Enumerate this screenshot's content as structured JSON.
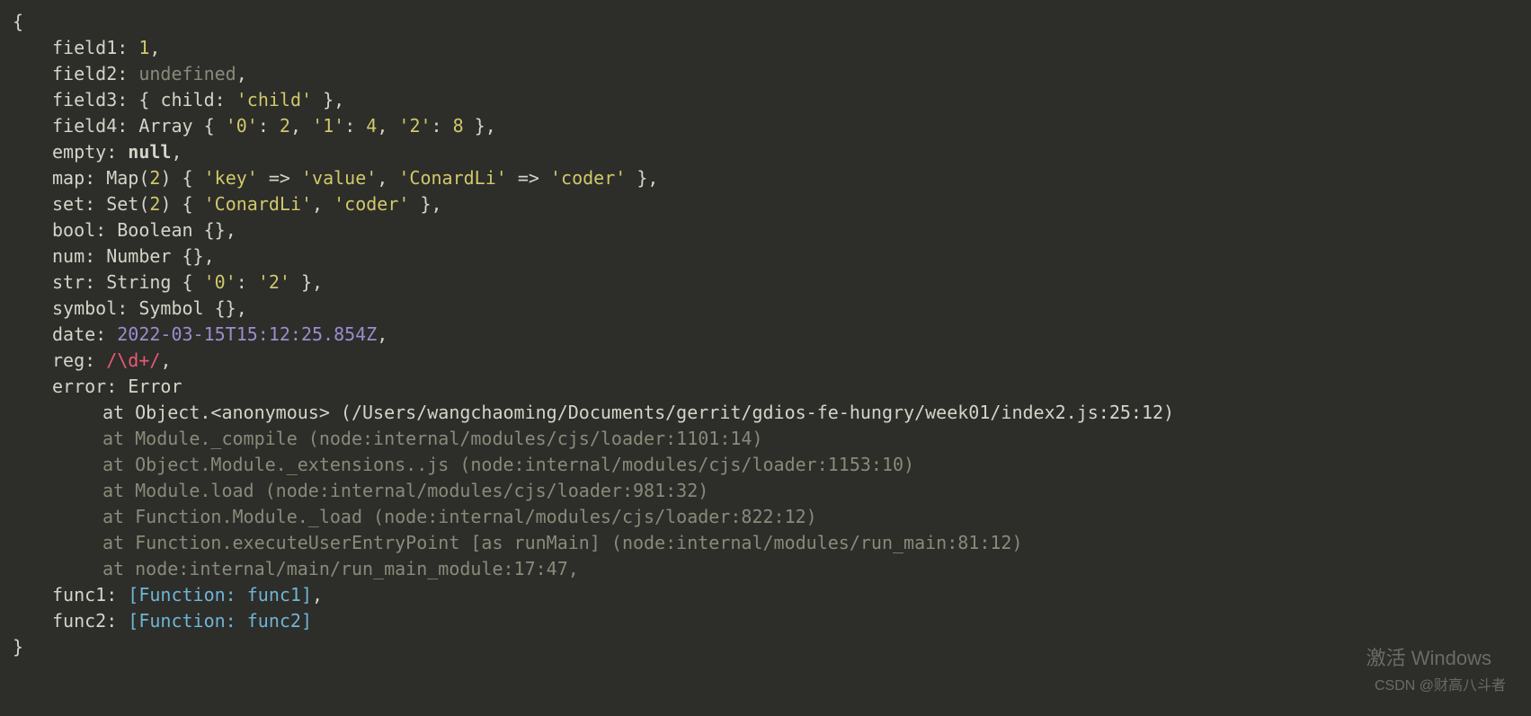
{
  "obj": {
    "open_brace": "{",
    "field1": {
      "key": "field1:",
      "value": "1",
      "comma": ","
    },
    "field2": {
      "key": "field2:",
      "value": "undefined",
      "comma": ","
    },
    "field3": {
      "key": "field3:",
      "child_key": "child:",
      "child_val": "'child'",
      "comma": ","
    },
    "field4": {
      "key": "field4:",
      "type": "Array",
      "p0k": "'0'",
      "p0v": "2",
      "p1k": "'1'",
      "p1v": "4",
      "p2k": "'2'",
      "p2v": "8",
      "comma": ","
    },
    "empty": {
      "key": "empty:",
      "value": "null",
      "comma": ","
    },
    "map": {
      "key": "map:",
      "type": "Map",
      "size": "2",
      "e0k": "'key'",
      "e0v": "'value'",
      "e1k": "'ConardLi'",
      "e1v": "'coder'",
      "comma": ","
    },
    "set": {
      "key": "set:",
      "type": "Set",
      "size": "2",
      "v0": "'ConardLi'",
      "v1": "'coder'",
      "comma": ","
    },
    "bool": {
      "key": "bool:",
      "type": "Boolean",
      "comma": ","
    },
    "numline": {
      "key": "num:",
      "type": "Number",
      "comma": ","
    },
    "strline": {
      "key": "str:",
      "type": "String",
      "k0": "'0'",
      "v0": "'2'",
      "comma": ","
    },
    "symbol": {
      "key": "symbol:",
      "type": "Symbol",
      "comma": ","
    },
    "dateline": {
      "key": "date:",
      "value": "2022-03-15T15:12:25.854Z",
      "comma": ","
    },
    "reg": {
      "key": "reg:",
      "value": "/\\d+/",
      "comma": ","
    },
    "error": {
      "key": "error:",
      "type": "Error",
      "trace": [
        "at Object.<anonymous> (/Users/wangchaoming/Documents/gerrit/gdios-fe-hungry/week01/index2.js:25:12)",
        "at Module._compile (node:internal/modules/cjs/loader:1101:14)",
        "at Object.Module._extensions..js (node:internal/modules/cjs/loader:1153:10)",
        "at Module.load (node:internal/modules/cjs/loader:981:32)",
        "at Function.Module._load (node:internal/modules/cjs/loader:822:12)",
        "at Function.executeUserEntryPoint [as runMain] (node:internal/modules/run_main:81:12)",
        "at node:internal/main/run_main_module:17:47,"
      ]
    },
    "func1": {
      "key": "func1:",
      "value": "[Function: func1]",
      "comma": ","
    },
    "func2": {
      "key": "func2:",
      "value": "[Function: func2]"
    },
    "close_brace": "}"
  },
  "watermarks": {
    "w1": "激活 Windows",
    "w2": "CSDN @财高八斗者"
  }
}
